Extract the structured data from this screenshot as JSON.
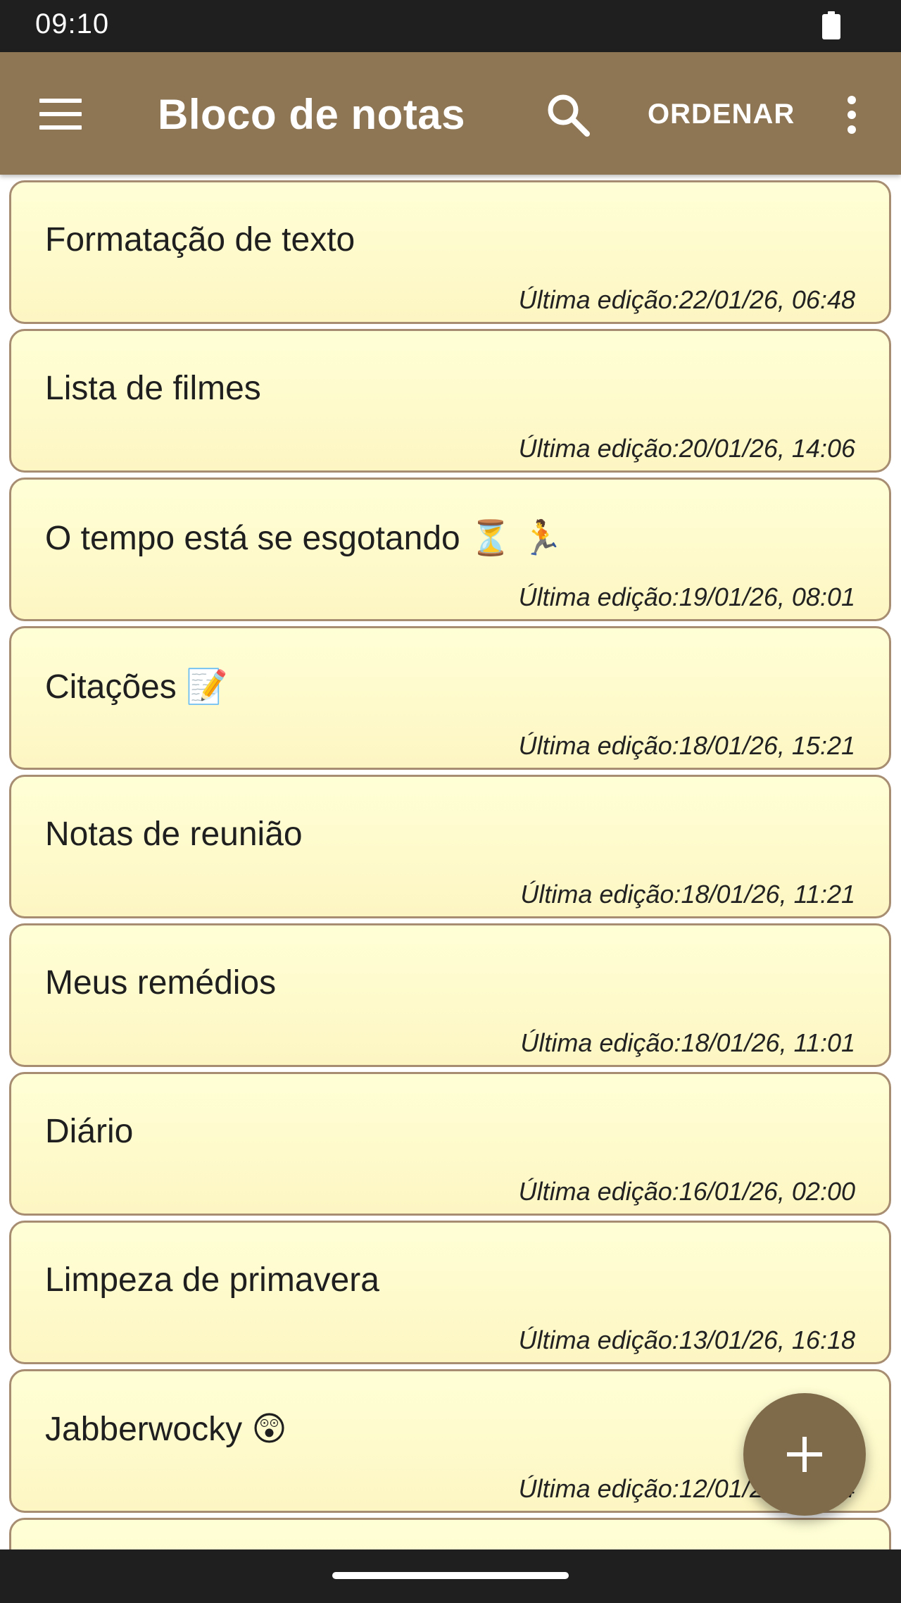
{
  "status_bar": {
    "time": "09:10"
  },
  "app_bar": {
    "title": "Bloco de notas",
    "sort_label": "ORDENAR",
    "icons": {
      "menu": "menu-icon",
      "search": "search-icon",
      "more": "more-vert-icon"
    },
    "color": "#8e7655"
  },
  "notes": [
    {
      "title": "Formatação de texto",
      "edited": "Última edição:22/01/26, 06:48"
    },
    {
      "title": "Lista de filmes",
      "edited": "Última edição:20/01/26, 14:06"
    },
    {
      "title": "O tempo está se esgotando ⏳ 🏃",
      "edited": "Última edição:19/01/26, 08:01"
    },
    {
      "title": "Citações 📝",
      "edited": "Última edição:18/01/26, 15:21"
    },
    {
      "title": "Notas de reunião",
      "edited": "Última edição:18/01/26, 11:21"
    },
    {
      "title": "Meus remédios",
      "edited": "Última edição:18/01/26, 11:01"
    },
    {
      "title": "Diário",
      "edited": "Última edição:16/01/26, 02:00"
    },
    {
      "title": "Limpeza de primavera",
      "edited": "Última edição:13/01/26, 16:18"
    },
    {
      "title": "Jabberwocky 😲",
      "edited": "Última edição:12/01/26, 14:04"
    },
    {
      "title": "",
      "edited": ""
    }
  ],
  "fab": {
    "icon": "plus-icon",
    "color": "#7f6a49"
  },
  "colors": {
    "card_border": "#a78e72",
    "card_fill": "#ffffd6"
  }
}
